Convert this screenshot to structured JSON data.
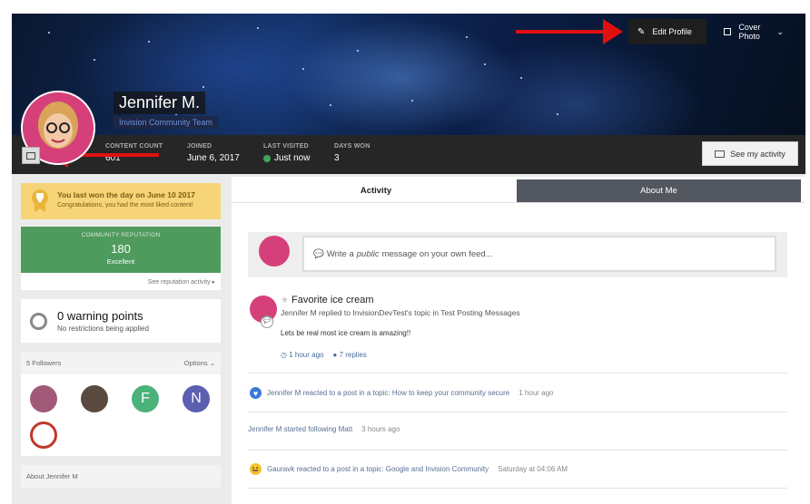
{
  "cover": {
    "edit_profile_label": "Edit Profile",
    "cover_photo_label": "Cover Photo",
    "cover_photo_caret": "⌄"
  },
  "profile": {
    "name": "Jennifer M.",
    "group": "Invision Community Team"
  },
  "stats": [
    {
      "label": "CONTENT COUNT",
      "value": "601"
    },
    {
      "label": "JOINED",
      "value": "June 6, 2017"
    },
    {
      "label": "LAST VISITED",
      "value": "Just now",
      "online": true
    },
    {
      "label": "DAYS WON",
      "value": "3"
    }
  ],
  "see_activity_label": "See my activity",
  "sidebar": {
    "won_title": "You last won the day on June 10 2017",
    "won_sub": "Congratulations, you had the most liked content!",
    "rep_label": "COMMUNITY REPUTATION",
    "rep_value": "180",
    "rep_status": "Excellent",
    "rep_link": "See reputation activity ▸",
    "warn_title": "0 warning points",
    "warn_sub": "No restrictions being applied",
    "followers_title": "5 Followers",
    "followers_options": "Options ⌄",
    "followers": [
      {
        "initial": "",
        "color": "#a05a78"
      },
      {
        "initial": "",
        "color": "#5a4a40"
      },
      {
        "initial": "F",
        "color": "#4bb27a"
      },
      {
        "initial": "N",
        "color": "#5b5fb0"
      },
      {
        "initial": "",
        "color": "#c0392b"
      }
    ],
    "about_title": "About Jennifer M"
  },
  "tabs": [
    {
      "label": "Activity",
      "active": true
    },
    {
      "label": "About Me",
      "active": false
    }
  ],
  "composer": {
    "placeholder_prefix": "Write a ",
    "placeholder_em": "public",
    "placeholder_suffix": " message on your own feed..."
  },
  "feed": {
    "post_title": "Favorite ice cream",
    "post_sub": "Jennifer M replied to InvisionDevTest's topic in Test Posting Messages",
    "post_body": "Lets be real most ice cream is amazing!!",
    "post_time": "1 hour ago",
    "post_replies": "7 replies",
    "item2_text": "Jennifer M reacted to a post in a topic: How to keep your community secure",
    "item2_time": "1 hour ago",
    "item3_text": "Jennifer M started following Matt",
    "item3_time": "3 hours ago",
    "item4_text": "Gauravk reacted to a post in a topic: Google and Invision Community",
    "item4_time": "Saturday at 04:06 AM"
  }
}
